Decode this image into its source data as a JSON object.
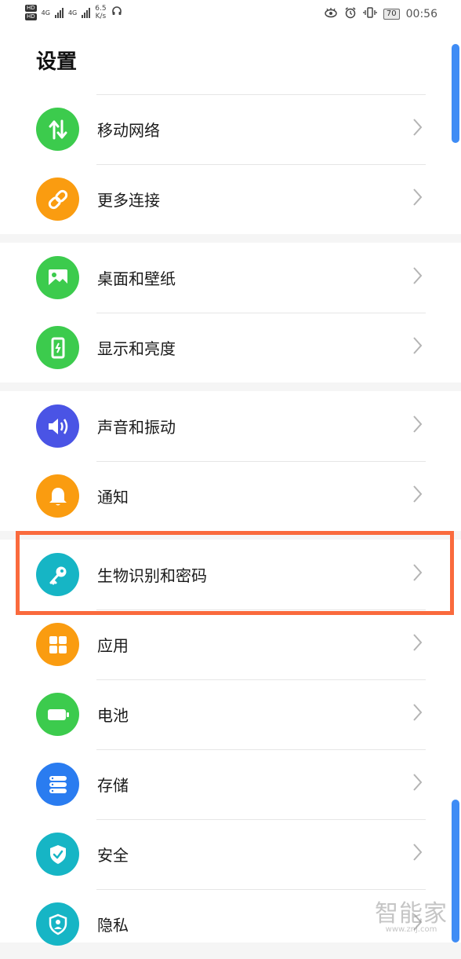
{
  "statusbar": {
    "hd1": "HD",
    "hd2": "HD",
    "net1": "4G",
    "net2": "4G",
    "speed_value": "6.5",
    "speed_unit": "K/s",
    "battery": "70",
    "time": "00:56"
  },
  "header": {
    "title": "设置"
  },
  "items": [
    {
      "label": "移动网络",
      "icon": "mobile-data-icon",
      "color": "#3ccb4d"
    },
    {
      "label": "更多连接",
      "icon": "link-icon",
      "color": "#fa9c10"
    },
    {
      "label": "桌面和壁纸",
      "icon": "wallpaper-icon",
      "color": "#3ccb4d"
    },
    {
      "label": "显示和亮度",
      "icon": "display-icon",
      "color": "#3ccb4d"
    },
    {
      "label": "声音和振动",
      "icon": "sound-icon",
      "color": "#4a54e5"
    },
    {
      "label": "通知",
      "icon": "bell-icon",
      "color": "#fa9c10"
    },
    {
      "label": "生物识别和密码",
      "icon": "key-icon",
      "color": "#16b5c5"
    },
    {
      "label": "应用",
      "icon": "apps-icon",
      "color": "#fa9c10"
    },
    {
      "label": "电池",
      "icon": "battery-icon",
      "color": "#3ccb4d"
    },
    {
      "label": "存储",
      "icon": "storage-icon",
      "color": "#2a7cf0"
    },
    {
      "label": "安全",
      "icon": "shield-check-icon",
      "color": "#16b5c5"
    },
    {
      "label": "隐私",
      "icon": "privacy-icon",
      "color": "#16b5c5"
    }
  ],
  "highlight_color": "#fa6a3d",
  "watermark": {
    "main": "智能家",
    "sub": "www.znj.com"
  }
}
